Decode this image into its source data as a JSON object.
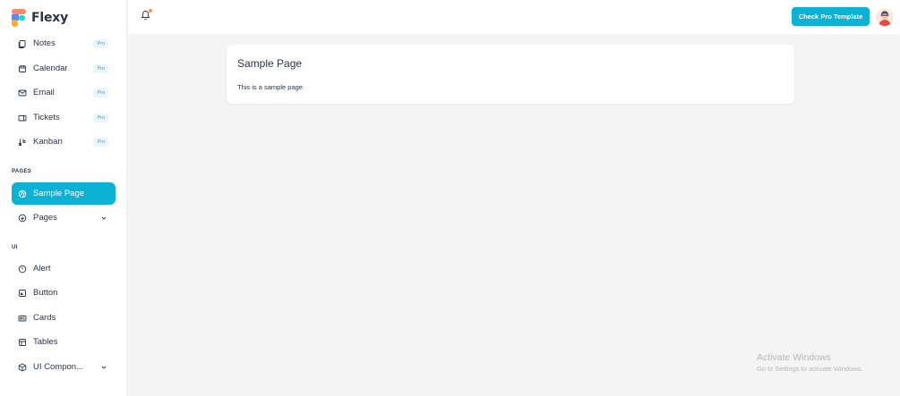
{
  "brand": {
    "name": "Flexy"
  },
  "sidebar": {
    "apps": [
      {
        "label": "Notes",
        "icon": "notes-icon",
        "badge": "Pro"
      },
      {
        "label": "Calendar",
        "icon": "calendar-icon",
        "badge": "Pro"
      },
      {
        "label": "Email",
        "icon": "email-icon",
        "badge": "Pro"
      },
      {
        "label": "Tickets",
        "icon": "ticket-icon",
        "badge": "Pro"
      },
      {
        "label": "Kanban",
        "icon": "kanban-icon",
        "badge": "Pro"
      }
    ],
    "pages_caption": "PAGES",
    "pages": [
      {
        "label": "Sample Page",
        "icon": "aperture-icon",
        "active": true
      },
      {
        "label": "Pages",
        "icon": "layers-icon",
        "expandable": true
      }
    ],
    "ui_caption": "UI",
    "ui": [
      {
        "label": "Alert",
        "icon": "alert-circle-icon"
      },
      {
        "label": "Button",
        "icon": "button-icon"
      },
      {
        "label": "Cards",
        "icon": "cards-icon"
      },
      {
        "label": "Tables",
        "icon": "table-icon"
      },
      {
        "label": "UI Compon...",
        "icon": "box-icon",
        "expandable": true
      }
    ]
  },
  "topbar": {
    "notification_icon": "bell-icon",
    "pro_button_label": "Check Pro Template",
    "avatar_icon": "user-avatar"
  },
  "main": {
    "card_title": "Sample Page",
    "card_text": "This is a sample page"
  },
  "watermark": {
    "line1": "Activate Windows",
    "line2": "Go to Settings to activate Windows."
  },
  "colors": {
    "accent": "#0bb2d4",
    "text": "#2a3547",
    "background": "#f4f4f4",
    "notification_dot": "#fa896b"
  }
}
